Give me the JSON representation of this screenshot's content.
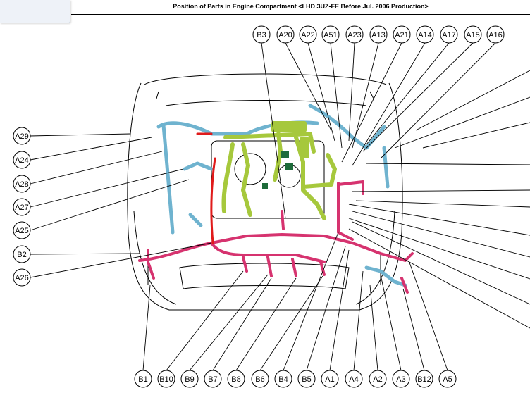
{
  "title": "Position of Parts in Engine Compartment <LHD 3UZ-FE Before Jul. 2006 Production>",
  "labels": {
    "top": [
      "B3",
      "A20",
      "A22",
      "A51",
      "A23",
      "A13",
      "A21",
      "A14",
      "A17",
      "A15",
      "A16"
    ],
    "left": [
      "A29",
      "A24",
      "A28",
      "A27",
      "A25",
      "B2",
      "A26"
    ],
    "bottom": [
      "B1",
      "B10",
      "B9",
      "B7",
      "B8",
      "B6",
      "B4",
      "B5",
      "A1",
      "A4",
      "A2",
      "A3",
      "B12",
      "A5"
    ]
  },
  "colors": {
    "harness_green": "#a6c83c",
    "harness_blue": "#6fb3cf",
    "harness_pink": "#d6336f",
    "harness_red": "#e01b1b"
  }
}
